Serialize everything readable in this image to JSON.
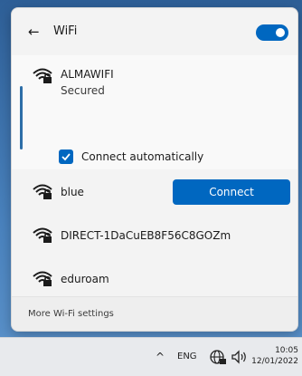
{
  "header": {
    "title": "WiFi",
    "wifi_enabled": true
  },
  "active_network": {
    "ssid": "ALMAWIFI",
    "security": "Secured",
    "connect_automatically_label": "Connect automatically",
    "connect_automatically_checked": true,
    "connect_button": "Connect"
  },
  "networks": [
    {
      "ssid": "blue",
      "secured": true
    },
    {
      "ssid": "DIRECT-1DaCuEB8F56C8GOZm",
      "secured": true
    },
    {
      "ssid": "eduroam",
      "secured": true
    }
  ],
  "footer": {
    "settings_link": "More Wi-Fi settings"
  },
  "taskbar": {
    "chevron": "^",
    "language": "ENG",
    "time": "10:05",
    "date": "12/01/2022"
  },
  "colors": {
    "accent": "#0067c0",
    "panel_bg": "#f3f3f3"
  }
}
